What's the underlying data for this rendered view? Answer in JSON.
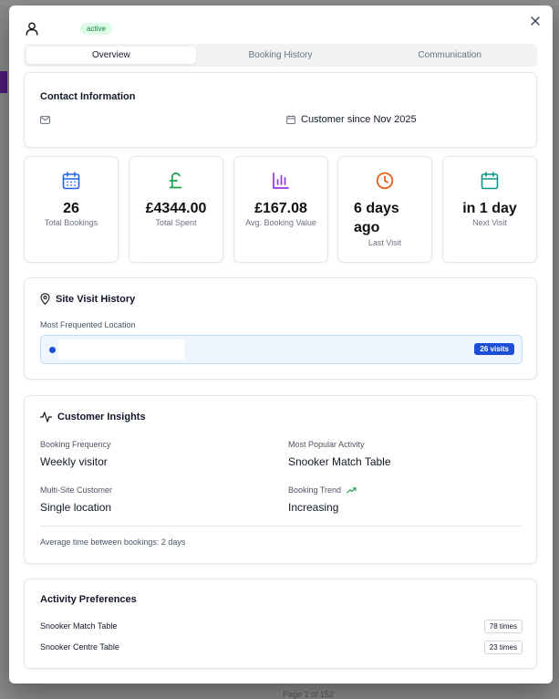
{
  "header": {
    "status": "active"
  },
  "tabs": [
    {
      "label": "Overview",
      "active": true
    },
    {
      "label": "Booking History",
      "active": false
    },
    {
      "label": "Communication",
      "active": false
    }
  ],
  "contact": {
    "title": "Contact Information",
    "since": "Customer since Nov 2025"
  },
  "stats": [
    {
      "value": "26",
      "label": "Total Bookings",
      "icon": "calendar-icon",
      "color": "#2563eb"
    },
    {
      "value": "£4344.00",
      "label": "Total Spent",
      "icon": "pound-icon",
      "color": "#16a34a"
    },
    {
      "value": "£167.08",
      "label": "Avg. Booking Value",
      "icon": "bar-chart-icon",
      "color": "#9333ea"
    },
    {
      "value": "6 days ago",
      "label": "Last Visit",
      "icon": "clock-icon",
      "color": "#ea580c"
    },
    {
      "value": "in 1 day",
      "label": "Next Visit",
      "icon": "calendar-icon",
      "color": "#0d9488"
    }
  ],
  "site": {
    "title": "Site Visit History",
    "subtitle": "Most Frequented Location",
    "location_name": "",
    "visits": "26 visits"
  },
  "insights": {
    "title": "Customer Insights",
    "frequency_label": "Booking Frequency",
    "frequency_value": "Weekly visitor",
    "activity_label": "Most Popular Activity",
    "activity_value": "Snooker Match Table",
    "multisite_label": "Multi-Site Customer",
    "multisite_value": "Single location",
    "trend_label": "Booking Trend",
    "trend_value": "Increasing",
    "avg_text": "Average time between bookings: 2 days"
  },
  "preferences": {
    "title": "Activity Preferences",
    "items": [
      {
        "name": "Snooker Match Table",
        "count": "78 times"
      },
      {
        "name": "Snooker Centre Table",
        "count": "23 times"
      }
    ]
  },
  "background": {
    "footer_text": "Page 1 of 152"
  },
  "colors": {
    "accent": "#1d4ed8",
    "badge_bg": "#dcfce7",
    "badge_text": "#15803d"
  }
}
